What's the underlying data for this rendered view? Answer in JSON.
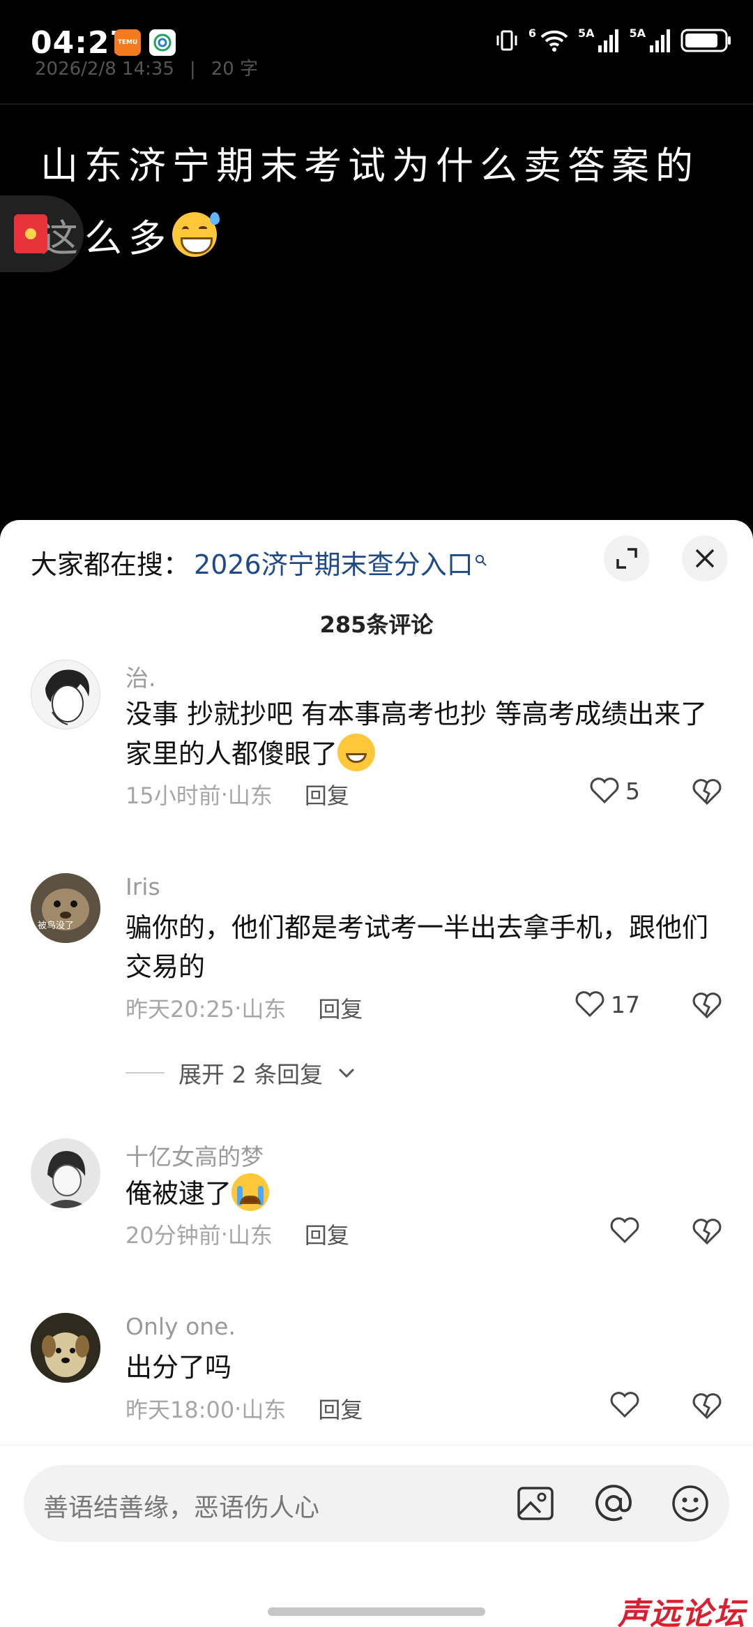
{
  "status": {
    "time": "04:27",
    "temu_label": "TEMU",
    "net1": "5A",
    "net2": "5A",
    "wifi_label": "6"
  },
  "post": {
    "date": "2026/2/8 14:35",
    "extra": "20 字",
    "title_line1": "山东济宁期末考试为什么卖答案的",
    "title_line2": "这么多"
  },
  "sheet": {
    "search_prefix": "大家都在搜：",
    "search_link": "2026济宁期末查分入口",
    "comment_count": "285条评论"
  },
  "comments": [
    {
      "user": "治.",
      "text": "没事 抄就抄吧 有本事高考也抄 等高考成绩出来了 家里的人都傻眼了",
      "time": "15小时前",
      "location": "山东",
      "reply": "回复",
      "likes": "5"
    },
    {
      "user": "Iris",
      "text": "骗你的，他们都是考试考一半出去拿手机，跟他们交易的",
      "time": "昨天20:25",
      "location": "山东",
      "reply": "回复",
      "likes": "17",
      "avatar_text": "被鸟没了",
      "expand": "展开 2 条回复"
    },
    {
      "user": "十亿女高的梦",
      "text": "俺被逮了",
      "time": "20分钟前",
      "location": "山东",
      "reply": "回复",
      "likes": ""
    },
    {
      "user": "Only one.",
      "text": "出分了吗",
      "time": "昨天18:00",
      "location": "山东",
      "reply": "回复",
      "likes": ""
    }
  ],
  "input": {
    "placeholder": "善语结善缘，恶语伤人心"
  },
  "watermark": "声远论坛",
  "colors": {
    "link": "#1f4a8a",
    "background_top": "#000000",
    "sheet": "#ffffff"
  }
}
